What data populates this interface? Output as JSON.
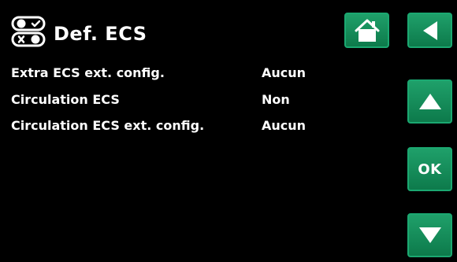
{
  "header": {
    "title": "Def. ECS",
    "icon": "settings-toggle-icon"
  },
  "navigation": {
    "home_icon": "home-icon",
    "back_icon": "back-arrow-icon",
    "up_icon": "up-arrow-icon",
    "ok_label": "OK",
    "down_icon": "down-arrow-icon"
  },
  "rows": [
    {
      "label": "Extra ECS ext. config.",
      "value": "Aucun"
    },
    {
      "label": "Circulation ECS",
      "value": "Non"
    },
    {
      "label": "Circulation ECS ext. config.",
      "value": "Aucun"
    }
  ],
  "colors": {
    "background": "#000000",
    "button_green": "#1a9a64",
    "text": "#ffffff"
  }
}
